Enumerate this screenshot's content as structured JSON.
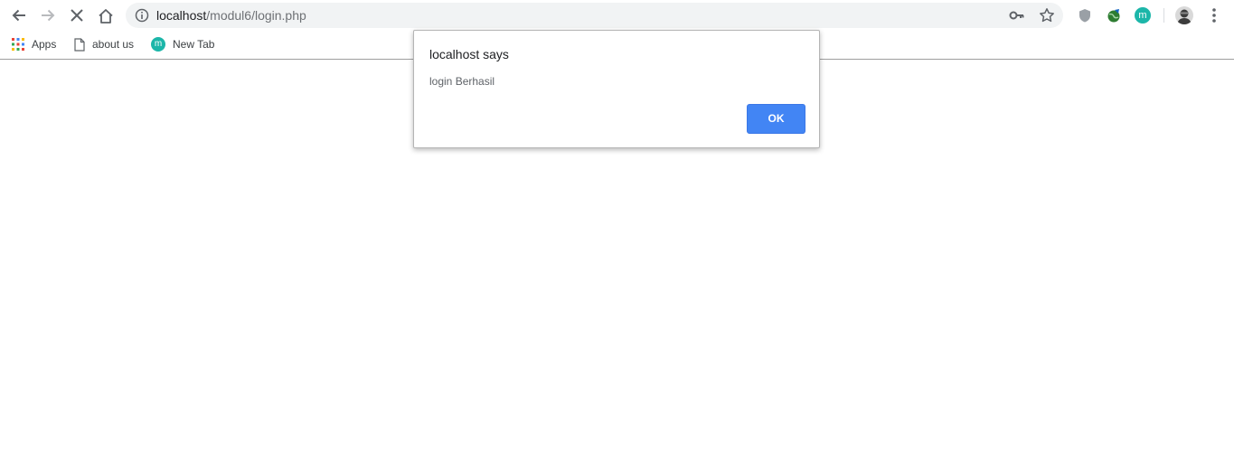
{
  "toolbar": {
    "back_icon": "arrow-left-icon",
    "forward_icon": "arrow-right-icon",
    "stop_icon": "close-icon",
    "home_icon": "home-icon",
    "url_host": "localhost",
    "url_path": "/modul6/login.php",
    "info_icon": "info-icon",
    "key_icon": "key-icon",
    "star_icon": "star-icon",
    "extensions": [
      {
        "name": "shield-extension-icon"
      },
      {
        "name": "globe-extension-icon"
      },
      {
        "name": "m-extension-icon",
        "letter": "m"
      }
    ],
    "menu_icon": "kebab-menu-icon"
  },
  "bookmarks": [
    {
      "label": "Apps",
      "icon": "apps-grid-icon"
    },
    {
      "label": "about us",
      "icon": "page-icon"
    },
    {
      "label": "New Tab",
      "icon": "m-icon",
      "letter": "m"
    }
  ],
  "dialog": {
    "title": "localhost says",
    "message": "login Berhasil",
    "ok_label": "OK"
  },
  "colors": {
    "accent": "#4285f4",
    "omnibox_bg": "#f1f3f4",
    "teal": "#1cb6a9"
  }
}
